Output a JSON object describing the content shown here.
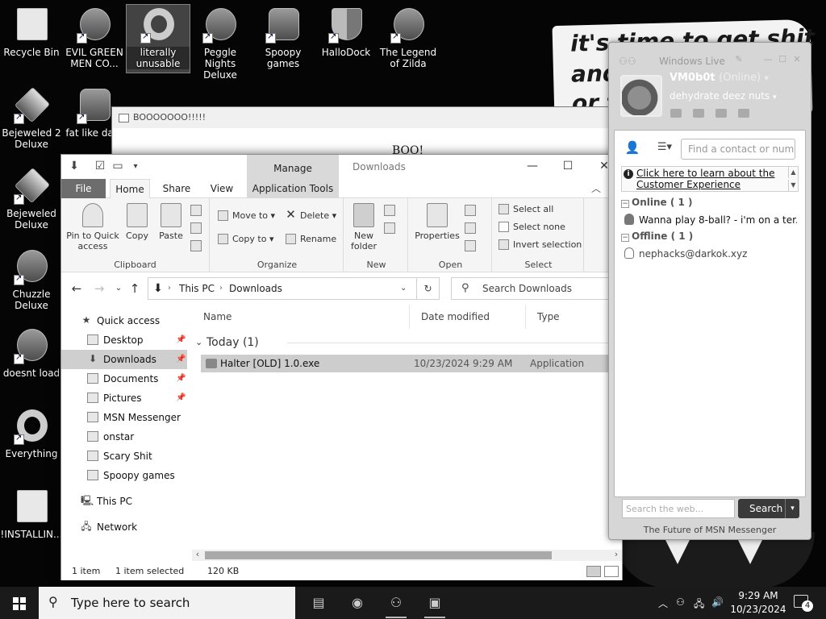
{
  "desktop": {
    "banner_lines": [
      "it's time to get shit",
      "and",
      "or t"
    ],
    "icons": [
      {
        "label": "Recycle Bin"
      },
      {
        "label": "EVIL GREEN MEN CO..."
      },
      {
        "label": "literally unusable"
      },
      {
        "label": "Peggle Nights Deluxe"
      },
      {
        "label": "Spoopy games"
      },
      {
        "label": "HalloDock"
      },
      {
        "label": "The Legend of Zilda"
      },
      {
        "label": "Bejeweled 2 Deluxe"
      },
      {
        "label": "fat like dark"
      },
      {
        "label": "Bejeweled Deluxe"
      },
      {
        "label": "Chuzzle Deluxe"
      },
      {
        "label": "doesnt load"
      },
      {
        "label": "Everything"
      },
      {
        "label": "!INSTALLIN..."
      }
    ]
  },
  "boo_window": {
    "title": "BOOOOOOO!!!!!",
    "body": "BOO!"
  },
  "explorer": {
    "title": "Downloads",
    "context_tab": "Manage",
    "tabs": {
      "file": "File",
      "home": "Home",
      "share": "Share",
      "view": "View",
      "app_tools": "Application Tools"
    },
    "ribbon": {
      "clipboard": {
        "pin": "Pin to Quick access",
        "copy": "Copy",
        "paste": "Paste",
        "group": "Clipboard"
      },
      "organize": {
        "move_to": "Move to",
        "copy_to": "Copy to",
        "delete": "Delete",
        "rename": "Rename",
        "group": "Organize"
      },
      "new": {
        "new_folder": "New folder",
        "group": "New"
      },
      "open": {
        "properties": "Properties",
        "group": "Open"
      },
      "select": {
        "select_all": "Select all",
        "select_none": "Select none",
        "invert": "Invert selection",
        "group": "Select"
      }
    },
    "address": {
      "this_pc": "This PC",
      "downloads": "Downloads"
    },
    "search_placeholder": "Search Downloads",
    "nav": {
      "quick_access": "Quick access",
      "items": [
        "Desktop",
        "Downloads",
        "Documents",
        "Pictures",
        "MSN Messenger",
        "onstar",
        "Scary Shit",
        "Spoopy games"
      ],
      "this_pc": "This PC",
      "network": "Network"
    },
    "columns": {
      "name": "Name",
      "date": "Date modified",
      "type": "Type"
    },
    "group_header": "Today (1)",
    "files": [
      {
        "name": "Halter [OLD] 1.0.exe",
        "date": "10/23/2024 9:29 AM",
        "type": "Application"
      }
    ],
    "status": {
      "items": "1 item",
      "selected": "1 item selected",
      "size": "120 KB"
    }
  },
  "msn": {
    "title": "Windows Live",
    "name": "VM0b0t",
    "status": "(Online)",
    "personal_message": "dehydrate deez nuts",
    "find_placeholder": "Find a contact or number",
    "info_link": "Click here to learn about the Customer Experience",
    "online_group": "Online ( 1 )",
    "offline_group": "Offline ( 1 )",
    "online_contacts": [
      "Wanna play 8-ball? - i'm on a ter..."
    ],
    "offline_contacts": [
      "nephacks@darkok.xyz"
    ],
    "web_search_placeholder": "Search the web...",
    "search_button": "Search",
    "footer": "The Future of MSN Messenger"
  },
  "taskbar": {
    "search_text": "Type here to search",
    "time": "9:29 AM",
    "date": "10/23/2024",
    "notification_count": "4"
  }
}
